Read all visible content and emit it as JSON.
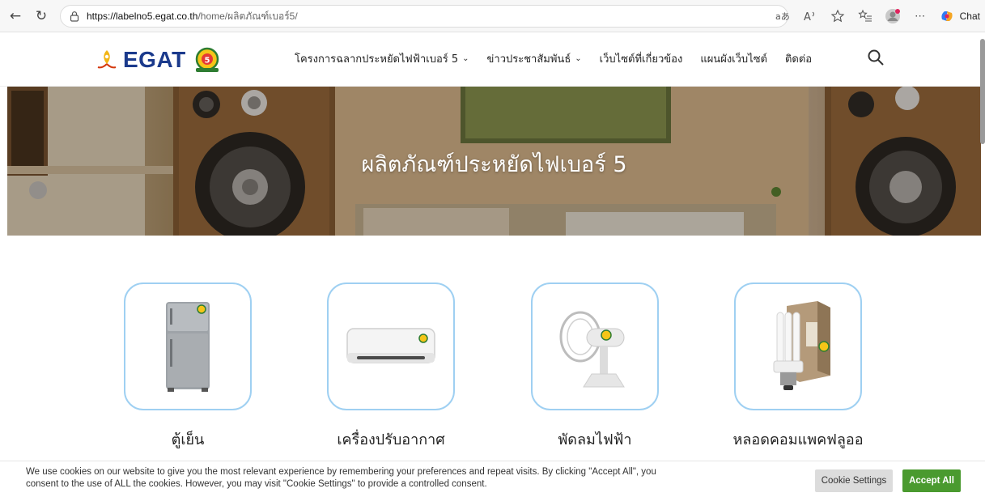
{
  "browser": {
    "url_host": "https://labelno5.egat.co.th",
    "url_rest": "/home/ผลิตภัณฑ์เบอร์5/",
    "chat_label": "Chat"
  },
  "header": {
    "logo_text": "EGAT",
    "menu": [
      {
        "label": "โครงการฉลากประหยัดไฟฟ้าเบอร์ 5",
        "has_dropdown": true
      },
      {
        "label": "ข่าวประชาสัมพันธ์",
        "has_dropdown": true
      },
      {
        "label": "เว็บไซต์ที่เกี่ยวข้อง",
        "has_dropdown": false
      },
      {
        "label": "แผนผังเว็บไซต์",
        "has_dropdown": false
      },
      {
        "label": "ติดต่อ",
        "has_dropdown": false
      }
    ]
  },
  "hero": {
    "title": "ผลิตภัณฑ์ประหยัดไฟเบอร์ 5"
  },
  "products": [
    {
      "label": "ตู้เย็น",
      "icon": "refrigerator-icon"
    },
    {
      "label": "เครื่องปรับอากาศ",
      "icon": "air-conditioner-icon"
    },
    {
      "label": "พัดลมไฟฟ้า",
      "icon": "electric-fan-icon"
    },
    {
      "label": "หลอดคอมแพคฟลูออ",
      "icon": "compact-fluorescent-lamp-icon"
    }
  ],
  "cookie": {
    "text": "We use cookies on our website to give you the most relevant experience by remembering your preferences and repeat visits. By clicking \"Accept All\", you consent to the use of ALL the cookies. However, you may visit \"Cookie Settings\" to provide a controlled consent.",
    "settings_label": "Cookie Settings",
    "accept_label": "Accept All"
  },
  "colors": {
    "accent_blue": "#1b3a8c",
    "card_border": "#9fd0f2",
    "accept_green": "#4a9a2f"
  }
}
